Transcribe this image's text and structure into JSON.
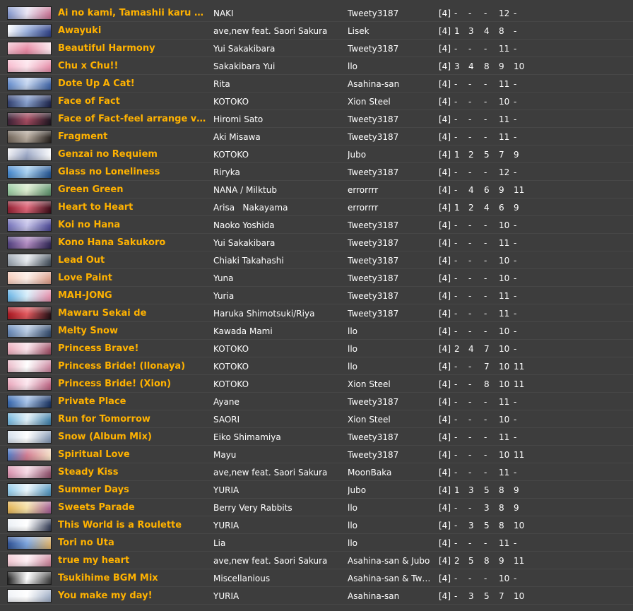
{
  "songs": [
    {
      "title": "Ai no kami, Tamashii karu mono ...",
      "artist": "NAKI",
      "uploader": "Tweety3187",
      "players": "[4]",
      "difficulties": [
        "-",
        "-",
        "-",
        "12",
        "-"
      ],
      "banner": [
        "#7a8fc8",
        "#e9e4f2",
        "#c46d8e"
      ]
    },
    {
      "title": "Awayuki",
      "artist": "ave,new feat. Saori Sakura",
      "uploader": "Lisek",
      "players": "[4]",
      "difficulties": [
        "1",
        "3",
        "4",
        "8",
        "-"
      ],
      "banner": [
        "#ffffff",
        "#9ab0dc",
        "#2d3e82"
      ]
    },
    {
      "title": "Beautiful Harmony",
      "artist": "Yui Sakakibara",
      "uploader": "Tweety3187",
      "players": "[4]",
      "difficulties": [
        "-",
        "-",
        "-",
        "11",
        "-"
      ],
      "banner": [
        "#f2c2cf",
        "#e78aa4",
        "#fbe9ef"
      ]
    },
    {
      "title": "Chu x Chu!!",
      "artist": "Sakakibara Yui",
      "uploader": "llo",
      "players": "[4]",
      "difficulties": [
        "3",
        "4",
        "8",
        "9",
        "10"
      ],
      "banner": [
        "#f7b6cb",
        "#fde4ec",
        "#e48aa6"
      ]
    },
    {
      "title": "Dote Up A Cat!",
      "artist": "Rita",
      "uploader": "Asahina-san",
      "players": "[4]",
      "difficulties": [
        "-",
        "-",
        "-",
        "11",
        "-"
      ],
      "banner": [
        "#5d86c9",
        "#c5d6f0",
        "#3b5fa1"
      ]
    },
    {
      "title": "Face of Fact",
      "artist": "KOTOKO",
      "uploader": "Xion Steel",
      "players": "[4]",
      "difficulties": [
        "-",
        "-",
        "-",
        "10",
        "-"
      ],
      "banner": [
        "#2c3a6b",
        "#8aa2cf",
        "#1a2148"
      ]
    },
    {
      "title": "Face of Fact-feel arrange ver.-",
      "artist": "Hiromi Sato",
      "uploader": "Tweety3187",
      "players": "[4]",
      "difficulties": [
        "-",
        "-",
        "-",
        "11",
        "-"
      ],
      "banner": [
        "#352035",
        "#a64d62",
        "#1b1520"
      ]
    },
    {
      "title": "Fragment",
      "artist": "Aki Misawa",
      "uploader": "Tweety3187",
      "players": "[4]",
      "difficulties": [
        "-",
        "-",
        "-",
        "11",
        "-"
      ],
      "banner": [
        "#6b6055",
        "#b9ada0",
        "#26211d"
      ]
    },
    {
      "title": "Genzai no Requiem",
      "artist": "KOTOKO",
      "uploader": "Jubo",
      "players": "[4]",
      "difficulties": [
        "1",
        "2",
        "5",
        "7",
        "9"
      ],
      "banner": [
        "#f3f3f6",
        "#9aa6c4",
        "#ffffff"
      ]
    },
    {
      "title": "Glass no Loneliness",
      "artist": "Riryka",
      "uploader": "Tweety3187",
      "players": "[4]",
      "difficulties": [
        "-",
        "-",
        "-",
        "12",
        "-"
      ],
      "banner": [
        "#3a7ec7",
        "#a9d1f0",
        "#1f4f8c"
      ]
    },
    {
      "title": "Green Green",
      "artist": "NANA / Milktub",
      "uploader": "errorrrr",
      "players": "[4]",
      "difficulties": [
        "-",
        "4",
        "6",
        "9",
        "11"
      ],
      "banner": [
        "#8fc49a",
        "#dceccf",
        "#5b8f6a"
      ]
    },
    {
      "title": "Heart to Heart",
      "artist": "Arisa   Nakayama",
      "uploader": "errorrrr",
      "players": "[4]",
      "difficulties": [
        "1",
        "2",
        "4",
        "6",
        "9"
      ],
      "banner": [
        "#8a1a2c",
        "#e0687a",
        "#3a0b17"
      ]
    },
    {
      "title": "Koi no Hana",
      "artist": "Naoko Yoshida",
      "uploader": "Tweety3187",
      "players": "[4]",
      "difficulties": [
        "-",
        "-",
        "-",
        "10",
        "-"
      ],
      "banner": [
        "#6d6bb5",
        "#c7c4ea",
        "#474491"
      ]
    },
    {
      "title": "Kono Hana Sakukoro",
      "artist": "Yui Sakakibara",
      "uploader": "Tweety3187",
      "players": "[4]",
      "difficulties": [
        "-",
        "-",
        "-",
        "11",
        "-"
      ],
      "banner": [
        "#4a3b7a",
        "#b48ec4",
        "#2c2452"
      ]
    },
    {
      "title": "Lead Out",
      "artist": "Chiaki Takahashi",
      "uploader": "Tweety3187",
      "players": "[4]",
      "difficulties": [
        "-",
        "-",
        "-",
        "10",
        "-"
      ],
      "banner": [
        "#8f9aa6",
        "#e7ebef",
        "#3e4a56"
      ]
    },
    {
      "title": "Love Paint",
      "artist": "Yuna",
      "uploader": "Tweety3187",
      "players": "[4]",
      "difficulties": [
        "-",
        "-",
        "-",
        "10",
        "-"
      ],
      "banner": [
        "#f4c7b5",
        "#fdeee6",
        "#d99a86"
      ]
    },
    {
      "title": "MAH-JONG",
      "artist": "Yuria",
      "uploader": "Tweety3187",
      "players": "[4]",
      "difficulties": [
        "-",
        "-",
        "-",
        "11",
        "-"
      ],
      "banner": [
        "#5faee3",
        "#d7eefa",
        "#e48aa6"
      ]
    },
    {
      "title": "Mawaru Sekai de",
      "artist": "Haruka Shimotsuki/Riya",
      "uploader": "Tweety3187",
      "players": "[4]",
      "difficulties": [
        "-",
        "-",
        "-",
        "11",
        "-"
      ],
      "banner": [
        "#a3121c",
        "#e35a5f",
        "#1c0d12"
      ]
    },
    {
      "title": "Melty Snow",
      "artist": "Kawada Mami",
      "uploader": "llo",
      "players": "[4]",
      "difficulties": [
        "-",
        "-",
        "-",
        "10",
        "-"
      ],
      "banner": [
        "#5d7fb0",
        "#b9cbe2",
        "#2e4566"
      ]
    },
    {
      "title": "Princess Brave!",
      "artist": "KOTOKO",
      "uploader": "llo",
      "players": "[4]",
      "difficulties": [
        "2",
        "4",
        "7",
        "10",
        "-"
      ],
      "banner": [
        "#e9a6b6",
        "#fbe3ea",
        "#9a4a61"
      ]
    },
    {
      "title": "Princess Bride! (llonaya)",
      "artist": "KOTOKO",
      "uploader": "llo",
      "players": "[4]",
      "difficulties": [
        "-",
        "-",
        "7",
        "10",
        "11"
      ],
      "banner": [
        "#e8b3c3",
        "#ffffff",
        "#c77f99"
      ]
    },
    {
      "title": "Princess Bride! (Xion)",
      "artist": "KOTOKO",
      "uploader": "Xion Steel",
      "players": "[4]",
      "difficulties": [
        "-",
        "-",
        "8",
        "10",
        "11"
      ],
      "banner": [
        "#e7a1b7",
        "#fce6ee",
        "#b95f7e"
      ]
    },
    {
      "title": "Private Place",
      "artist": "Ayane",
      "uploader": "Tweety3187",
      "players": "[4]",
      "difficulties": [
        "-",
        "-",
        "-",
        "11",
        "-"
      ],
      "banner": [
        "#2d5fa8",
        "#a7c3e8",
        "#152e5c"
      ]
    },
    {
      "title": "Run for Tomorrow",
      "artist": "SAORI",
      "uploader": "Xion Steel",
      "players": "[4]",
      "difficulties": [
        "-",
        "-",
        "-",
        "10",
        "-"
      ],
      "banner": [
        "#6ab0d9",
        "#dff0f8",
        "#3a7aa3"
      ]
    },
    {
      "title": "Snow (Album Mix)",
      "artist": "Eiko Shimamiya",
      "uploader": "Tweety3187",
      "players": "[4]",
      "difficulties": [
        "-",
        "-",
        "-",
        "11",
        "-"
      ],
      "banner": [
        "#cfdbe9",
        "#ffffff",
        "#7f93b0"
      ]
    },
    {
      "title": "Spiritual Love",
      "artist": "Mayu",
      "uploader": "Tweety3187",
      "players": "[4]",
      "difficulties": [
        "-",
        "-",
        "-",
        "10",
        "11"
      ],
      "banner": [
        "#4a7cc9",
        "#d27d92",
        "#f5e3c7"
      ]
    },
    {
      "title": "Steady Kiss",
      "artist": "ave,new feat. Saori Sakura",
      "uploader": "MoonBaka",
      "players": "[4]",
      "difficulties": [
        "-",
        "-",
        "-",
        "11",
        "-"
      ],
      "banner": [
        "#d68aa8",
        "#f5d9e4",
        "#8a4a66"
      ]
    },
    {
      "title": "Summer Days",
      "artist": "YURIA",
      "uploader": "Jubo",
      "players": "[4]",
      "difficulties": [
        "1",
        "3",
        "5",
        "8",
        "9"
      ],
      "banner": [
        "#89c5e6",
        "#e9f6fc",
        "#4b8fb8"
      ]
    },
    {
      "title": "Sweets Parade",
      "artist": "Berry Very Rabbits",
      "uploader": "llo",
      "players": "[4]",
      "difficulties": [
        "-",
        "-",
        "3",
        "8",
        "9"
      ],
      "banner": [
        "#e3b04f",
        "#f4e0a8",
        "#a05a93"
      ]
    },
    {
      "title": "This World is a Roulette",
      "artist": "YURIA",
      "uploader": "llo",
      "players": "[4]",
      "difficulties": [
        "-",
        "3",
        "5",
        "8",
        "10"
      ],
      "banner": [
        "#e9eef4",
        "#ffffff",
        "#2d3650"
      ]
    },
    {
      "title": "Tori no Uta",
      "artist": "Lia",
      "uploader": "llo",
      "players": "[4]",
      "difficulties": [
        "-",
        "-",
        "-",
        "11",
        "-"
      ],
      "banner": [
        "#2a4c8f",
        "#7ea6de",
        "#e0b36a"
      ]
    },
    {
      "title": "true my heart",
      "artist": "ave,new feat. Saori Sakura",
      "uploader": "Asahina-san & Jubo",
      "players": "[4]",
      "difficulties": [
        "2",
        "5",
        "8",
        "9",
        "11"
      ],
      "banner": [
        "#f0c4cf",
        "#fff0f4",
        "#c67f95"
      ]
    },
    {
      "title": "Tsukihime BGM Mix",
      "artist": "Miscellanious",
      "uploader": "Asahina-san & Twee...",
      "players": "[4]",
      "difficulties": [
        "-",
        "-",
        "-",
        "10",
        "-"
      ],
      "banner": [
        "#101010",
        "#ffffff",
        "#3a3a3a"
      ]
    },
    {
      "title": "You make my day!",
      "artist": "YURIA",
      "uploader": "Asahina-san",
      "players": "[4]",
      "difficulties": [
        "-",
        "3",
        "5",
        "7",
        "10"
      ],
      "banner": [
        "#eef1f6",
        "#ffffff",
        "#9aa9c2"
      ]
    }
  ]
}
